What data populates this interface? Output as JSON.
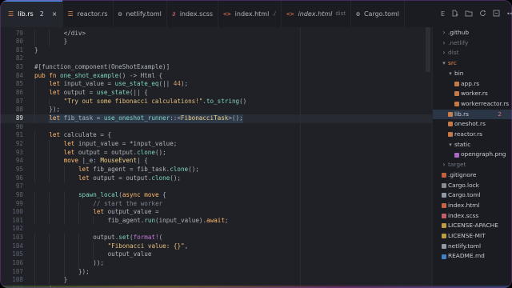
{
  "colors": {
    "tab_accent": "#4a90e2",
    "traffic_red": "#ed6a5e",
    "traffic_yellow": "#f5bf4f",
    "traffic_green": "#61c554",
    "rust_file": "#e38b4f",
    "toml_file": "#a7b0bd",
    "scss_file": "#e06c75",
    "html_file": "#e4704a",
    "folder": "#8c929c",
    "error_count": "#e06c75"
  },
  "tabs": [
    {
      "icon": "rust-file-icon",
      "name": "lib.rs",
      "badge": "2",
      "close": "×",
      "active": true
    },
    {
      "icon": "rust-file-icon",
      "name": "reactor.rs",
      "badge": "",
      "close": "",
      "active": false
    },
    {
      "icon": "gear-icon",
      "name": "netlify.toml",
      "badge": "",
      "close": "",
      "active": false
    },
    {
      "icon": "scss-file-icon",
      "name": "index.scss",
      "badge": "",
      "close": "",
      "active": false
    },
    {
      "icon": "code-file-icon",
      "name": "index.html",
      "sub": "./",
      "close": "",
      "active": false
    },
    {
      "icon": "code-file-icon",
      "name": "index.html",
      "sub": "dist",
      "close": "",
      "active": false,
      "italic": true
    },
    {
      "icon": "gear-icon",
      "name": "Cargo.toml",
      "badge": "",
      "close": "",
      "active": false
    }
  ],
  "tab_actions": {
    "explorer_label": "E"
  },
  "editor": {
    "current_line": 89,
    "lines": [
      {
        "n": 79,
        "ind": 2,
        "code": [
          [
            "p",
            "</div>"
          ]
        ]
      },
      {
        "n": 80,
        "ind": 2,
        "code": [
          [
            "p",
            "}"
          ]
        ]
      },
      {
        "n": 81,
        "ind": 0,
        "code": [
          [
            "p",
            "}"
          ]
        ]
      },
      {
        "n": 82,
        "ind": 0,
        "code": []
      },
      {
        "n": 83,
        "ind": 0,
        "code": [
          [
            "p",
            "#[function_component(OneShotExample)]"
          ]
        ]
      },
      {
        "n": 84,
        "ind": 0,
        "code": [
          [
            "k",
            "pub fn "
          ],
          [
            "f",
            "one_shot_example"
          ],
          [
            "p",
            "() -> Html {"
          ]
        ]
      },
      {
        "n": 85,
        "ind": 1,
        "code": [
          [
            "k",
            "let "
          ],
          [
            "p",
            "input_value = "
          ],
          [
            "f",
            "use_state_eq"
          ],
          [
            "p",
            "(|| "
          ],
          [
            "n",
            "44"
          ],
          [
            "p",
            ");"
          ]
        ]
      },
      {
        "n": 86,
        "ind": 1,
        "code": [
          [
            "k",
            "let "
          ],
          [
            "p",
            "output = "
          ],
          [
            "f",
            "use_state"
          ],
          [
            "p",
            "(|| {"
          ]
        ]
      },
      {
        "n": 87,
        "ind": 2,
        "code": [
          [
            "s",
            "\"Try out some fibonacci calculations!\""
          ],
          [
            "p",
            "."
          ],
          [
            "f",
            "to_string"
          ],
          [
            "p",
            "()"
          ]
        ]
      },
      {
        "n": 88,
        "ind": 1,
        "code": [
          [
            "p",
            "});"
          ]
        ]
      },
      {
        "n": 89,
        "ind": 1,
        "code": [
          [
            "k",
            "let "
          ],
          [
            "p",
            "fib_task = "
          ],
          [
            "f",
            "use_oneshot_runner"
          ],
          [
            "p",
            "::<"
          ],
          [
            "t",
            "FibonacciTask"
          ],
          [
            "p",
            ">();"
          ]
        ]
      },
      {
        "n": 90,
        "ind": 0,
        "code": []
      },
      {
        "n": 91,
        "ind": 1,
        "code": [
          [
            "k",
            "let "
          ],
          [
            "p",
            "calculate = {"
          ]
        ]
      },
      {
        "n": 92,
        "ind": 2,
        "code": [
          [
            "k",
            "let "
          ],
          [
            "p",
            "input_value = *input_value;"
          ]
        ]
      },
      {
        "n": 93,
        "ind": 2,
        "code": [
          [
            "k",
            "let "
          ],
          [
            "p",
            "output = output."
          ],
          [
            "f",
            "clone"
          ],
          [
            "p",
            "();"
          ]
        ]
      },
      {
        "n": 94,
        "ind": 2,
        "code": [
          [
            "k",
            "move "
          ],
          [
            "p",
            "|_e: "
          ],
          [
            "t",
            "MouseEvent"
          ],
          [
            "p",
            "| {"
          ]
        ]
      },
      {
        "n": 95,
        "ind": 3,
        "code": [
          [
            "k",
            "let "
          ],
          [
            "p",
            "fib_agent = fib_task."
          ],
          [
            "f",
            "clone"
          ],
          [
            "p",
            "();"
          ]
        ]
      },
      {
        "n": 96,
        "ind": 3,
        "code": [
          [
            "k",
            "let "
          ],
          [
            "p",
            "output = output."
          ],
          [
            "f",
            "clone"
          ],
          [
            "p",
            "();"
          ]
        ]
      },
      {
        "n": 97,
        "ind": 0,
        "code": []
      },
      {
        "n": 98,
        "ind": 3,
        "code": [
          [
            "f",
            "spawn_local"
          ],
          [
            "p",
            "("
          ],
          [
            "k",
            "async move "
          ],
          [
            "p",
            "{"
          ]
        ]
      },
      {
        "n": 99,
        "ind": 4,
        "code": [
          [
            "c",
            "// start the worker"
          ]
        ]
      },
      {
        "n": 100,
        "ind": 4,
        "code": [
          [
            "k",
            "let "
          ],
          [
            "p",
            "output_value ="
          ]
        ]
      },
      {
        "n": 101,
        "ind": 5,
        "code": [
          [
            "p",
            "fib_agent."
          ],
          [
            "f",
            "run"
          ],
          [
            "p",
            "(input_value)."
          ],
          [
            "k",
            "await"
          ],
          [
            "p",
            ";"
          ]
        ]
      },
      {
        "n": 102,
        "ind": 0,
        "code": []
      },
      {
        "n": 103,
        "ind": 4,
        "code": [
          [
            "p",
            "output."
          ],
          [
            "f",
            "set"
          ],
          [
            "p",
            "("
          ],
          [
            "m",
            "format!"
          ],
          [
            "p",
            "("
          ]
        ]
      },
      {
        "n": 104,
        "ind": 5,
        "code": [
          [
            "s",
            "\"Fibonacci value: {}\""
          ],
          [
            "p",
            ","
          ]
        ]
      },
      {
        "n": 105,
        "ind": 5,
        "code": [
          [
            "p",
            "output_value"
          ]
        ]
      },
      {
        "n": 106,
        "ind": 4,
        "code": [
          [
            "p",
            "));"
          ]
        ]
      },
      {
        "n": 107,
        "ind": 3,
        "code": [
          [
            "p",
            "});"
          ]
        ]
      },
      {
        "n": 108,
        "ind": 2,
        "code": [
          [
            "p",
            "}"
          ]
        ]
      },
      {
        "n": 109,
        "ind": 1,
        "code": [
          [
            "p",
            "};"
          ]
        ]
      }
    ]
  },
  "explorer": {
    "items": [
      {
        "label": ".github",
        "depth": 0,
        "kind": "folder",
        "open": false,
        "dim": false
      },
      {
        "label": ".netlify",
        "depth": 0,
        "kind": "folder",
        "open": false,
        "dim": true
      },
      {
        "label": "dist",
        "depth": 0,
        "kind": "folder",
        "open": false,
        "dim": true
      },
      {
        "label": "src",
        "depth": 0,
        "kind": "folder",
        "open": true,
        "dim": false,
        "color": "#e38b4f"
      },
      {
        "label": "bin",
        "depth": 1,
        "kind": "folder",
        "open": true,
        "dim": false
      },
      {
        "label": "app.rs",
        "depth": 2,
        "kind": "file",
        "dim": false
      },
      {
        "label": "worker.rs",
        "depth": 2,
        "kind": "file",
        "dim": false
      },
      {
        "label": "workerreactor.rs",
        "depth": 2,
        "kind": "file",
        "dim": false
      },
      {
        "label": "lib.rs",
        "depth": 1,
        "kind": "rust",
        "dim": false,
        "active": true,
        "count": "2"
      },
      {
        "label": "oneshot.rs",
        "depth": 1,
        "kind": "rust",
        "dim": false
      },
      {
        "label": "reactor.rs",
        "depth": 1,
        "kind": "rust",
        "dim": false
      },
      {
        "label": "static",
        "depth": 0,
        "kind": "folder",
        "open": true,
        "dim": false,
        "indent": 1
      },
      {
        "label": "opengraph.png",
        "depth": 2,
        "kind": "image",
        "dim": false
      },
      {
        "label": "target",
        "depth": 0,
        "kind": "folder",
        "open": false,
        "dim": true
      },
      {
        "label": ".gitignore",
        "depth": 0,
        "kind": "git",
        "dim": false
      },
      {
        "label": "Cargo.lock",
        "depth": 0,
        "kind": "lock",
        "dim": false
      },
      {
        "label": "Cargo.toml",
        "depth": 0,
        "kind": "toml",
        "dim": false
      },
      {
        "label": "index.html",
        "depth": 0,
        "kind": "html",
        "dim": false
      },
      {
        "label": "index.scss",
        "depth": 0,
        "kind": "scss",
        "dim": false
      },
      {
        "label": "LICENSE-APACHE",
        "depth": 0,
        "kind": "license",
        "dim": false
      },
      {
        "label": "LICENSE-MIT",
        "depth": 0,
        "kind": "license",
        "dim": false
      },
      {
        "label": "netlify.toml",
        "depth": 0,
        "kind": "toml",
        "dim": false
      },
      {
        "label": "README.md",
        "depth": 0,
        "kind": "md",
        "dim": false
      }
    ]
  }
}
